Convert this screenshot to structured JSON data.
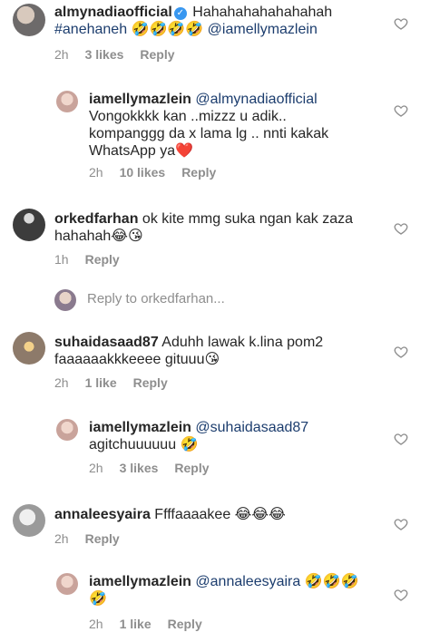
{
  "comments": [
    {
      "username": "almynadiaofficial",
      "text_a": " Hahahahahahahahah",
      "text_b": "#anehaneh 🤣🤣🤣🤣 ",
      "mention": "@iamellymazlein",
      "time": "2h",
      "likes": "3 likes",
      "reply": "Reply",
      "avatar_color": "#6d6a6a"
    },
    {
      "username": "iamellymazlein",
      "mention": "@almynadiaofficial",
      "text_a": "Vongokkkk kan ..mizzz u adik..",
      "text_b": "kompanggg da x lama lg .. nnti kakak",
      "text_c": "WhatsApp ya❤️",
      "time": "2h",
      "likes": "10 likes",
      "reply": "Reply",
      "avatar_color": "#c9a39b"
    },
    {
      "username": "orkedfarhan",
      "text_a": " ok kite mmg suka ngan kak zaza",
      "text_b": "hahahah😂😘",
      "time": "1h",
      "reply": "Reply",
      "avatar_color": "#3c3c3c"
    },
    {
      "username": "suhaidasaad87",
      "text_a": " Aduhh lawak k.lina pom2",
      "text_b": "faaaaaakkkeeee gituuu😘",
      "time": "2h",
      "likes": "1 like",
      "reply": "Reply",
      "avatar_color": "#8d7a6a"
    },
    {
      "username": "iamellymazlein",
      "mention": "@suhaidasaad87",
      "text_b": "agitchuuuuuu 🤣",
      "time": "2h",
      "likes": "3 likes",
      "reply": "Reply",
      "avatar_color": "#c9a39b"
    },
    {
      "username": "annaleesyaira",
      "text_a": " Ffffaaaakee 😂😂😂",
      "time": "2h",
      "reply": "Reply",
      "avatar_color": "#9a9a9a"
    },
    {
      "username": "iamellymazlein",
      "mention": "@annaleesyaira",
      "text_a": " 🤣🤣🤣",
      "text_b": "🤣",
      "time": "2h",
      "likes": "1 like",
      "reply": "Reply",
      "avatar_color": "#c9a39b"
    }
  ],
  "view_reply": {
    "text": "Reply to orkedfarhan..."
  },
  "icons": {
    "heart": "heart-icon",
    "verified": "verified-badge-icon"
  }
}
